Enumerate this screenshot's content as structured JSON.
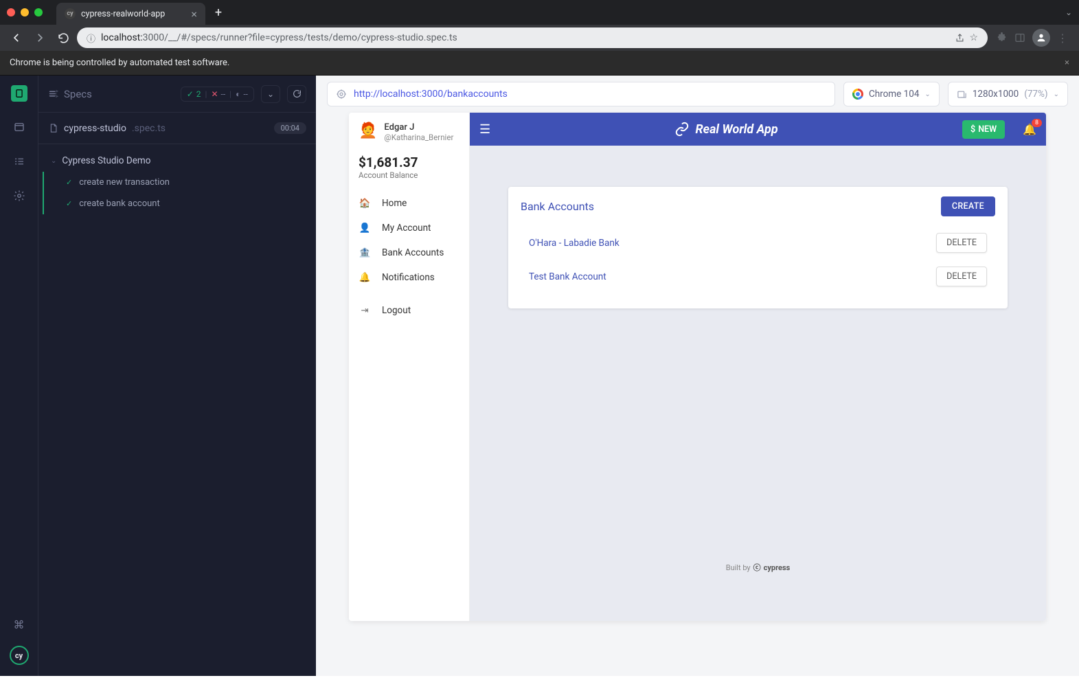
{
  "browser": {
    "tab_title": "cypress-realworld-app",
    "url_host": "localhost:",
    "url_port_path": "3000/__/#/specs/runner?file=cypress/tests/demo/cypress-studio.spec.ts",
    "automation_msg": "Chrome is being controlled by automated test software."
  },
  "runner": {
    "header_label": "Specs",
    "pass_count": "2",
    "fail_dash": "--",
    "pend_dash": "--",
    "spec_name": "cypress-studio",
    "spec_ext": ".spec.ts",
    "timer": "00:04",
    "group": "Cypress Studio Demo",
    "tests": [
      "create new transaction",
      "create bank account"
    ]
  },
  "aut": {
    "url": "http://localhost:3000/bankaccounts",
    "browser_label": "Chrome 104",
    "viewport": "1280x1000",
    "viewport_pct": "(77%)"
  },
  "rwa": {
    "user_name": "Edgar J",
    "user_handle": "@Katharina_Bernier",
    "balance": "$1,681.37",
    "balance_label": "Account Balance",
    "nav": {
      "home": "Home",
      "myaccount": "My Account",
      "bankaccounts": "Bank Accounts",
      "notifications": "Notifications",
      "logout": "Logout"
    },
    "app_title": "Real World App",
    "new_btn": "NEW",
    "badge": "8",
    "card_title": "Bank Accounts",
    "create_btn": "CREATE",
    "accounts": [
      {
        "name": "O'Hara - Labadie Bank",
        "del": "DELETE"
      },
      {
        "name": "Test Bank Account",
        "del": "DELETE"
      }
    ],
    "footer_prefix": "Built by",
    "footer_brand": "cypress"
  }
}
